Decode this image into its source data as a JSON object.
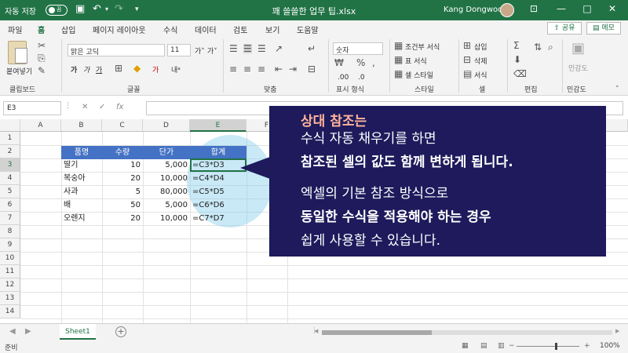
{
  "titlebar": {
    "autosave_label": "자동 저장",
    "autosave_toggle": "끔",
    "doc_title": "꽤 쓸쓸한 업무 팁.xlsx",
    "user_name": "Kang Dongwoo"
  },
  "tabs": [
    "파일",
    "홈",
    "삽입",
    "페이지 레이아웃",
    "수식",
    "데이터",
    "검토",
    "보기",
    "도움말"
  ],
  "active_tab": "홈",
  "share_label": "공유",
  "memo_label": "메모",
  "ribbon": {
    "paste_label": "붙여넣기",
    "font_name": "맑은 고딕",
    "font_size": "11",
    "number_format": "숫자",
    "cond_format": "조건부 서식",
    "table_format": "표 서식",
    "cell_style": "셀 스타일",
    "insert": "삽입",
    "delete": "삭제",
    "format": "서식",
    "sensitivity": "민감도",
    "groups": {
      "clipboard": "클립보드",
      "font": "글꼴",
      "align": "맞춤",
      "number": "표시 형식",
      "style": "스타일",
      "cells": "셀",
      "edit": "편집",
      "sensitivity": "민감도"
    }
  },
  "formula_bar": {
    "name_box": "E3",
    "fx": "fx"
  },
  "columns": [
    "A",
    "B",
    "C",
    "D",
    "E",
    "F"
  ],
  "rows": [
    "1",
    "2",
    "3",
    "4",
    "5",
    "6",
    "7",
    "8",
    "9",
    "10",
    "11",
    "12",
    "13",
    "14"
  ],
  "table": {
    "headers": [
      "품명",
      "수량",
      "단가",
      "합계"
    ],
    "rows": [
      [
        "딸기",
        "10",
        "5,000",
        "=C3*D3"
      ],
      [
        "복숭아",
        "20",
        "10,000",
        "=C4*D4"
      ],
      [
        "사과",
        "5",
        "80,000",
        "=C5*D5"
      ],
      [
        "배",
        "50",
        "5,000",
        "=C6*D6"
      ],
      [
        "오렌지",
        "20",
        "10,000",
        "=C7*D7"
      ]
    ]
  },
  "callout": {
    "line1": "상대 참조는",
    "line2": "수식 자동 채우기를 하면",
    "line3": "참조된 셀의 값도 함께 변하게 됩니다.",
    "line4": "엑셀의 기본 참조 방식으로",
    "line5": "동일한 수식을 적용해야 하는 경우",
    "line6": "쉽게 사용할 수 있습니다."
  },
  "sheet_tab": "Sheet1",
  "status": {
    "ready": "준비",
    "zoom": "100%"
  },
  "colors": {
    "excel_green": "#217346",
    "header_blue": "#4472c4",
    "callout_navy": "#1e1a5c",
    "accent": "#ffb39a"
  }
}
